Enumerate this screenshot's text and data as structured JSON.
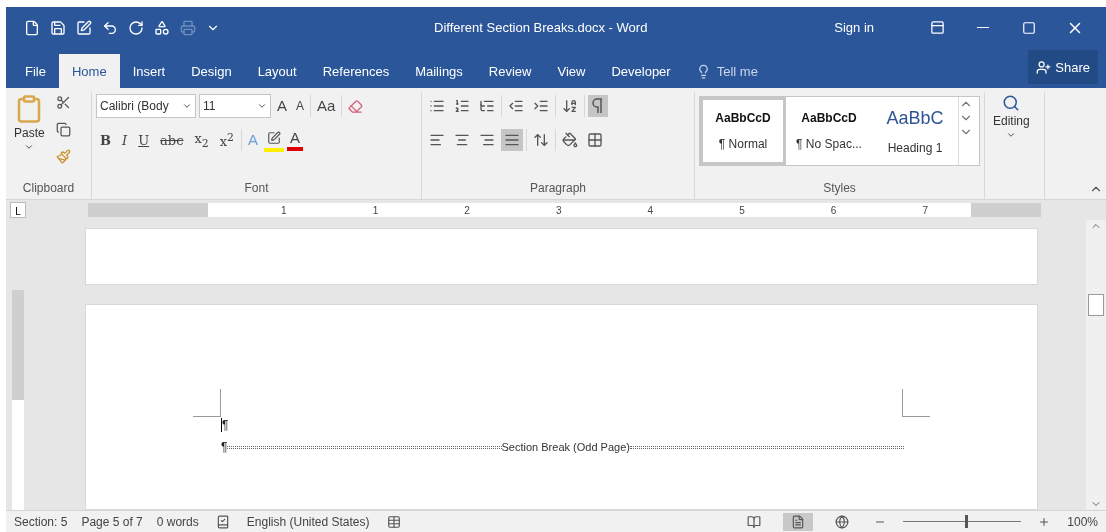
{
  "window": {
    "title": "Different Section Breaks.docx  -  Word",
    "sign_in": "Sign in"
  },
  "tabs": [
    {
      "label": "File",
      "selected": false
    },
    {
      "label": "Home",
      "selected": true
    },
    {
      "label": "Insert",
      "selected": false
    },
    {
      "label": "Design",
      "selected": false
    },
    {
      "label": "Layout",
      "selected": false
    },
    {
      "label": "References",
      "selected": false
    },
    {
      "label": "Mailings",
      "selected": false
    },
    {
      "label": "Review",
      "selected": false
    },
    {
      "label": "View",
      "selected": false
    },
    {
      "label": "Developer",
      "selected": false
    }
  ],
  "tell_me": {
    "placeholder": "Tell me"
  },
  "share": "Share",
  "ribbon": {
    "clipboard": {
      "label": "Clipboard",
      "paste": "Paste"
    },
    "font": {
      "label": "Font",
      "name": "Calibri (Body",
      "size": "11",
      "grow": "A",
      "shrink": "A",
      "change_case": "Aa",
      "formats": [
        {
          "kind": "bold",
          "text": "B"
        },
        {
          "kind": "italic",
          "text": "I"
        },
        {
          "kind": "underline",
          "text": "U"
        },
        {
          "kind": "strike",
          "text": "abc"
        },
        {
          "kind": "script",
          "text": "x$_{2}$"
        },
        {
          "kind": "script",
          "text": "x$^{2}$"
        }
      ],
      "effects": "A",
      "font_color": "A"
    },
    "paragraph": {
      "label": "Paragraph",
      "show_marks": true,
      "align": [
        {
          "selected": false
        },
        {
          "selected": false
        },
        {
          "selected": false
        },
        {
          "selected": true
        }
      ]
    },
    "styles": {
      "label": "Styles",
      "items": [
        {
          "preview": "AaBbCcD",
          "label": "¶ Normal",
          "selected": true,
          "kind": "body"
        },
        {
          "preview": "AaBbCcD",
          "label": "¶ No Spac...",
          "selected": false,
          "kind": "body"
        },
        {
          "preview": "AaBbC",
          "label": "Heading 1",
          "selected": false,
          "kind": "heading"
        }
      ]
    },
    "editing": {
      "label": "Editing"
    }
  },
  "ruler": {
    "tab_selector": "L",
    "numbers": [
      "1",
      "1",
      "2",
      "3",
      "4",
      "5",
      "6",
      "7"
    ]
  },
  "document": {
    "paragraph_mark": "¶",
    "break_mark": "¶",
    "section_break": "Section Break (Odd Page)"
  },
  "status_bar": {
    "items": [
      "Section: 5",
      "Page 5 of 7",
      "0 words"
    ],
    "language": "English (United States)",
    "views": [
      {
        "kind": "read",
        "selected": false
      },
      {
        "kind": "print",
        "selected": true
      },
      {
        "kind": "web",
        "selected": false
      }
    ],
    "zoom": {
      "level": 0.52,
      "reading": "100%"
    }
  }
}
